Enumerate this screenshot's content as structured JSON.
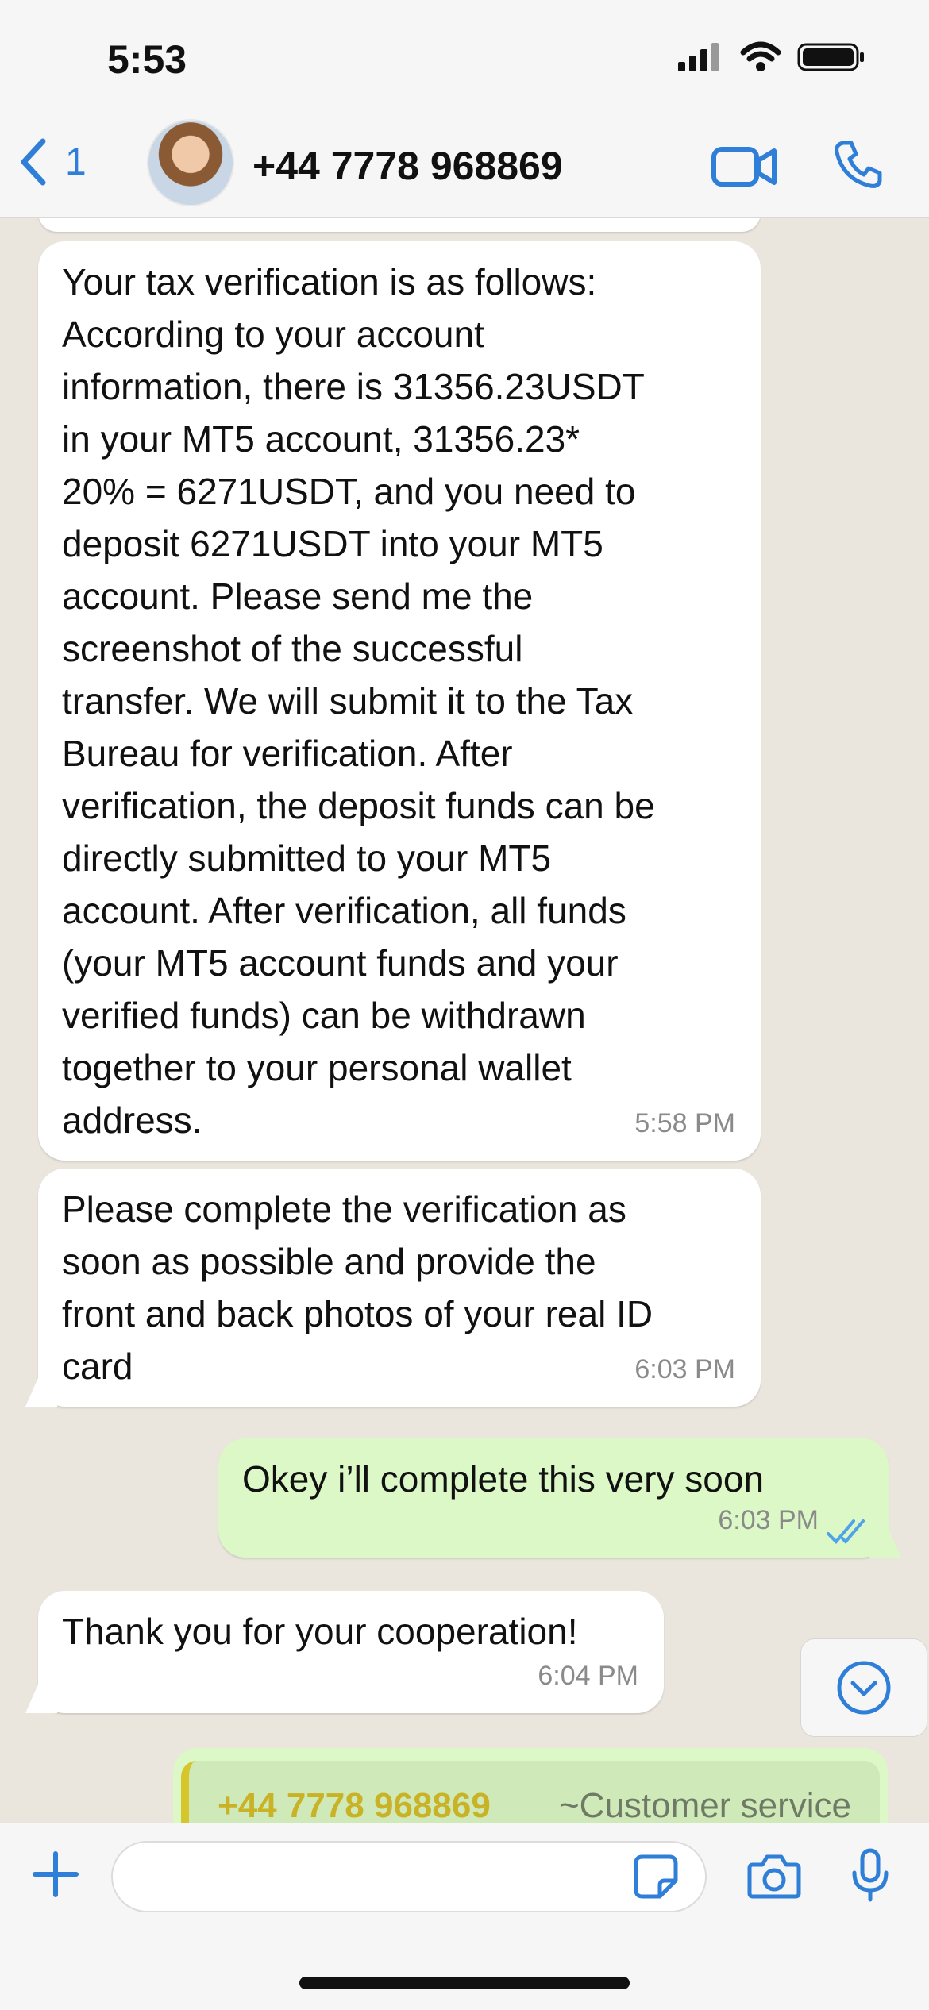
{
  "status_bar": {
    "time": "5:53"
  },
  "header": {
    "back_count": "1",
    "contact_name": "+44 7778 968869"
  },
  "messages": [
    {
      "direction": "incoming",
      "text": "Your tax verification is as follows:\nAccording to your account\ninformation, there is 31356.23USDT\nin your MT5 account, 31356.23*\n20% = 6271USDT, and you need to\ndeposit 6271USDT into your MT5\naccount. Please send me the\nscreenshot of the successful\ntransfer. We will submit it to the Tax\nBureau for verification. After\nverification, the deposit funds can be\ndirectly submitted to your MT5\naccount. After verification, all funds\n(your MT5 account funds and your\nverified funds) can be withdrawn\ntogether to your personal wallet\naddress.",
      "time": "5:58 PM"
    },
    {
      "direction": "incoming",
      "text": "Please complete the verification as\nsoon as possible and provide the\nfront and back photos of your real ID\ncard",
      "time": "6:03 PM"
    },
    {
      "direction": "outgoing",
      "text": "Okey i’ll complete this very soon",
      "time": "6:03 PM",
      "status": "read"
    },
    {
      "direction": "incoming",
      "text": "Thank you for your cooperation!",
      "time": "6:04 PM"
    }
  ],
  "quoted": {
    "number": "+44 7778 968869",
    "name": "~Customer service"
  },
  "colors": {
    "accent": "#2f7fd8",
    "outgoing_bubble": "#dbf8c6",
    "incoming_bubble": "#ffffff",
    "chat_background": "#ebe6dd"
  },
  "icons": {
    "back": "chevron-left-icon",
    "video": "video-camera-icon",
    "call": "phone-icon",
    "scroll_down": "chevron-down-circle-icon",
    "attach": "plus-icon",
    "sticker": "sticker-icon",
    "camera": "camera-icon",
    "mic": "microphone-icon"
  }
}
